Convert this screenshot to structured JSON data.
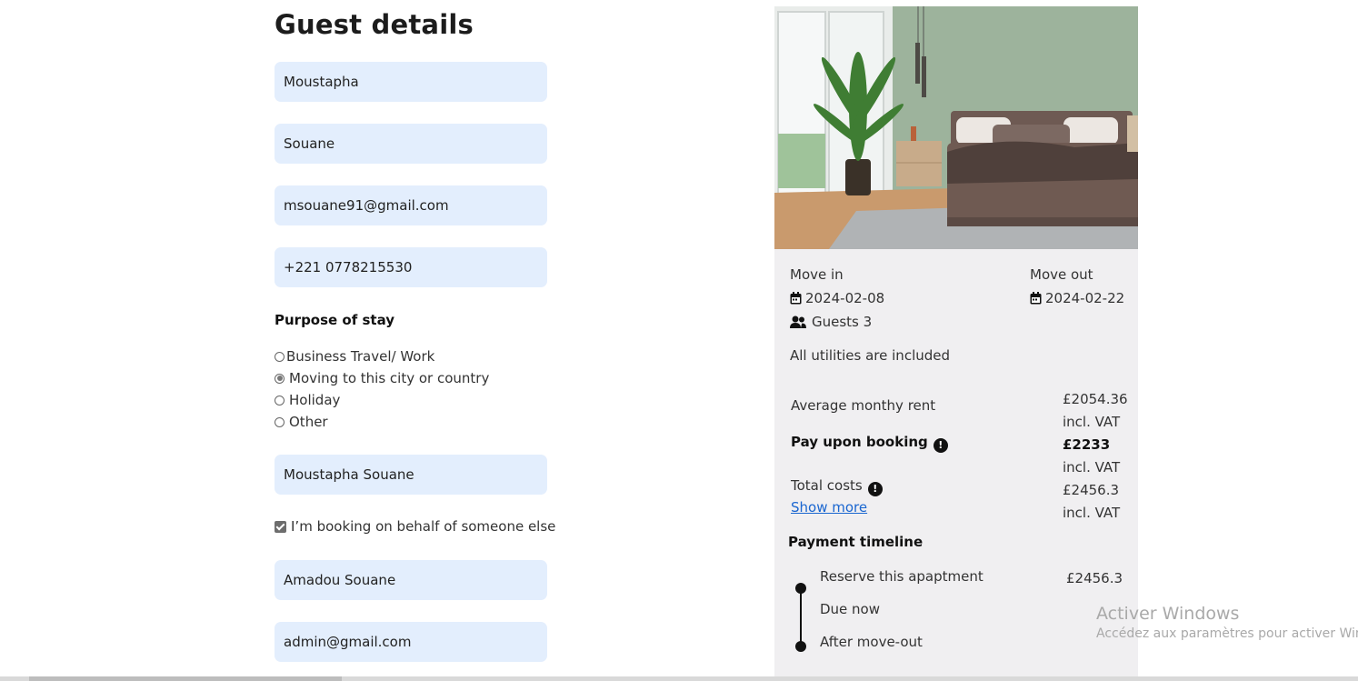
{
  "page": {
    "title": "Guest details"
  },
  "form": {
    "first_name": "Moustapha",
    "last_name": "Souane",
    "email": "msouane91@gmail.com",
    "phone": "+221 0778215530",
    "purpose_label": "Purpose of stay",
    "purpose_options": [
      {
        "label": "Business Travel/ Work",
        "checked": false
      },
      {
        "label": "Moving to this city or country",
        "checked": true
      },
      {
        "label": "Holiday",
        "checked": false
      },
      {
        "label": "Other",
        "checked": false
      }
    ],
    "full_name": "Moustapha Souane",
    "on_behalf_label": "I’m booking on behalf of someone else",
    "on_behalf_checked": true,
    "other_name": "Amadou Souane",
    "other_email": "admin@gmail.com"
  },
  "summary": {
    "move_in_label": "Move in",
    "move_in_date": "2024-02-08",
    "move_out_label": "Move out",
    "move_out_date": "2024-02-22",
    "guests": "Guests 3",
    "utilities": "All utilities are included",
    "avg_rent_label": "Average monthy rent",
    "avg_rent_value": "£2054.36",
    "vat": "incl. VAT",
    "pay_booking_label": "Pay upon booking",
    "pay_booking_value": "£2233",
    "total_label": "Total costs",
    "total_value": "£2456.3",
    "show_more": "Show more",
    "timeline_title": "Payment timeline",
    "timeline": [
      {
        "label": "Reserve this apaptment",
        "value": "£2456.3"
      },
      {
        "label": "Due now",
        "value": ""
      },
      {
        "label": "After move-out",
        "value": ""
      }
    ]
  },
  "os": {
    "activate_title": "Activer Windows",
    "activate_sub": "Accédez aux paramètres pour activer Windows."
  },
  "icons": {
    "calendar": "calendar-icon",
    "guests": "users-icon",
    "info": "info-icon"
  }
}
